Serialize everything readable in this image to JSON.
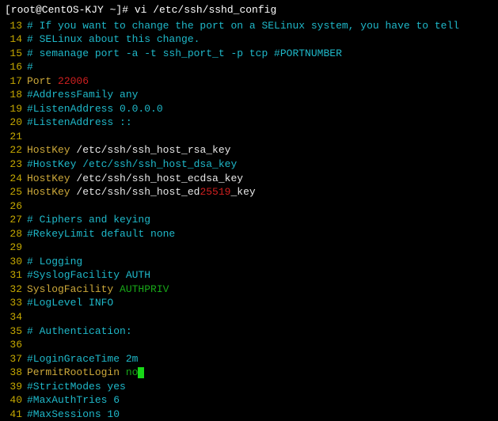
{
  "prompt": "[root@CentOS-KJY ~]# vi /etc/ssh/sshd_config",
  "lines": [
    {
      "num": 13,
      "segs": [
        {
          "c": "cyan",
          "t": "# If you want to change the port on a SELinux system, you have to tell"
        }
      ]
    },
    {
      "num": 14,
      "segs": [
        {
          "c": "cyan",
          "t": "# SELinux about this change."
        }
      ]
    },
    {
      "num": 15,
      "segs": [
        {
          "c": "cyan",
          "t": "# semanage port -a -t ssh_port_t -p tcp #PORTNUMBER"
        }
      ]
    },
    {
      "num": 16,
      "segs": [
        {
          "c": "cyan",
          "t": "#"
        }
      ]
    },
    {
      "num": 17,
      "segs": [
        {
          "c": "yellow",
          "t": "Port "
        },
        {
          "c": "red",
          "t": "22006"
        }
      ]
    },
    {
      "num": 18,
      "segs": [
        {
          "c": "cyan",
          "t": "#AddressFamily any"
        }
      ]
    },
    {
      "num": 19,
      "segs": [
        {
          "c": "cyan",
          "t": "#ListenAddress 0.0.0.0"
        }
      ]
    },
    {
      "num": 20,
      "segs": [
        {
          "c": "cyan",
          "t": "#ListenAddress ::"
        }
      ]
    },
    {
      "num": 21,
      "segs": []
    },
    {
      "num": 22,
      "segs": [
        {
          "c": "yellow",
          "t": "HostKey "
        },
        {
          "c": "white",
          "t": "/etc/ssh/ssh_host_rsa_key"
        }
      ]
    },
    {
      "num": 23,
      "segs": [
        {
          "c": "cyan",
          "t": "#HostKey /etc/ssh/ssh_host_dsa_key"
        }
      ]
    },
    {
      "num": 24,
      "segs": [
        {
          "c": "yellow",
          "t": "HostKey "
        },
        {
          "c": "white",
          "t": "/etc/ssh/ssh_host_ecdsa_key"
        }
      ]
    },
    {
      "num": 25,
      "segs": [
        {
          "c": "yellow",
          "t": "HostKey "
        },
        {
          "c": "white",
          "t": "/etc/ssh/ssh_host_ed"
        },
        {
          "c": "red",
          "t": "25519"
        },
        {
          "c": "white",
          "t": "_key"
        }
      ]
    },
    {
      "num": 26,
      "segs": []
    },
    {
      "num": 27,
      "segs": [
        {
          "c": "cyan",
          "t": "# Ciphers and keying"
        }
      ]
    },
    {
      "num": 28,
      "segs": [
        {
          "c": "cyan",
          "t": "#RekeyLimit default none"
        }
      ]
    },
    {
      "num": 29,
      "segs": []
    },
    {
      "num": 30,
      "segs": [
        {
          "c": "cyan",
          "t": "# Logging"
        }
      ]
    },
    {
      "num": 31,
      "segs": [
        {
          "c": "cyan",
          "t": "#SyslogFacility AUTH"
        }
      ]
    },
    {
      "num": 32,
      "segs": [
        {
          "c": "yellow",
          "t": "SyslogFacility "
        },
        {
          "c": "green",
          "t": "AUTHPRIV"
        }
      ]
    },
    {
      "num": 33,
      "segs": [
        {
          "c": "cyan",
          "t": "#LogLevel INFO"
        }
      ]
    },
    {
      "num": 34,
      "segs": []
    },
    {
      "num": 35,
      "segs": [
        {
          "c": "cyan",
          "t": "# Authentication:"
        }
      ]
    },
    {
      "num": 36,
      "segs": []
    },
    {
      "num": 37,
      "segs": [
        {
          "c": "cyan",
          "t": "#LoginGraceTime 2m"
        }
      ]
    },
    {
      "num": 38,
      "segs": [
        {
          "c": "yellow",
          "t": "PermitRootLogin "
        },
        {
          "c": "green",
          "t": "no"
        },
        {
          "cursor": true
        }
      ]
    },
    {
      "num": 39,
      "segs": [
        {
          "c": "cyan",
          "t": "#StrictModes yes"
        }
      ]
    },
    {
      "num": 40,
      "segs": [
        {
          "c": "cyan",
          "t": "#MaxAuthTries 6"
        }
      ]
    },
    {
      "num": 41,
      "segs": [
        {
          "c": "cyan",
          "t": "#MaxSessions 10"
        }
      ]
    }
  ]
}
